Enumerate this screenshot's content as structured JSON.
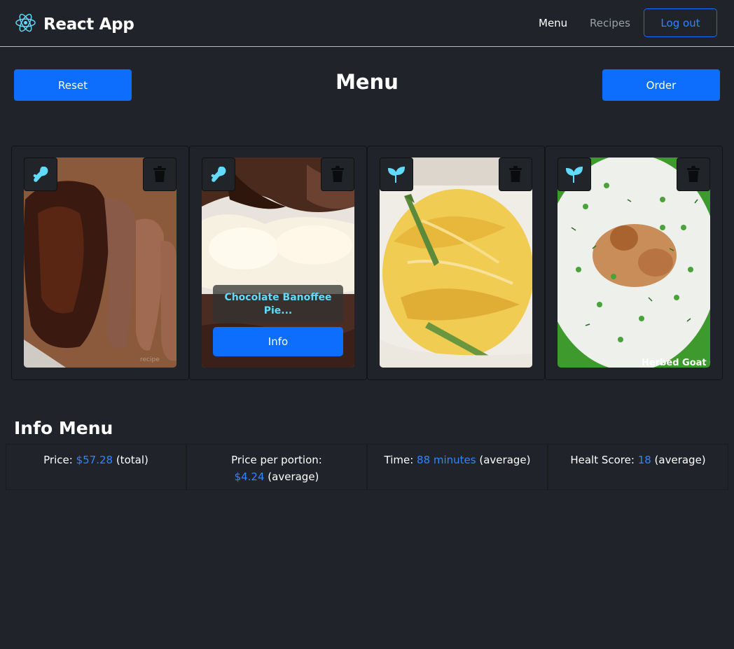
{
  "navbar": {
    "brand": "React App",
    "links": {
      "menu": "Menu",
      "recipes": "Recipes"
    },
    "logout_label": "Log out",
    "brand_icon": "react-logo-icon",
    "colors": {
      "react": "#61dafb",
      "primary": "#0d6efd",
      "background": "#202329"
    }
  },
  "header": {
    "reset_label": "Reset",
    "title": "Menu",
    "order_label": "Order"
  },
  "cards": [
    {
      "diet_icon": "drumstick-icon",
      "image": "beef-brisket",
      "title": "",
      "info_label": ""
    },
    {
      "diet_icon": "drumstick-icon",
      "image": "banoffee-pie",
      "title": "Chocolate Banoffee Pie...",
      "info_label": "Info"
    },
    {
      "diet_icon": "sprout-icon",
      "image": "pasta-asparagus",
      "title": "",
      "info_label": ""
    },
    {
      "diet_icon": "sprout-icon",
      "image": "goat-cheese-dip",
      "caption": "Herbed Goat C",
      "info_label": ""
    }
  ],
  "info_menu": {
    "title": "Info Menu",
    "price": {
      "label": "Price: ",
      "value": "$57.28",
      "suffix": " (total)"
    },
    "price_per_portion": {
      "label": "Price per portion: ",
      "value": "$4.24",
      "suffix": " (average)"
    },
    "time": {
      "label": "Time: ",
      "value": "88 minutes",
      "suffix": " (average)"
    },
    "health_score": {
      "label": "Healt Score: ",
      "value": "18",
      "suffix": " (average)"
    }
  }
}
